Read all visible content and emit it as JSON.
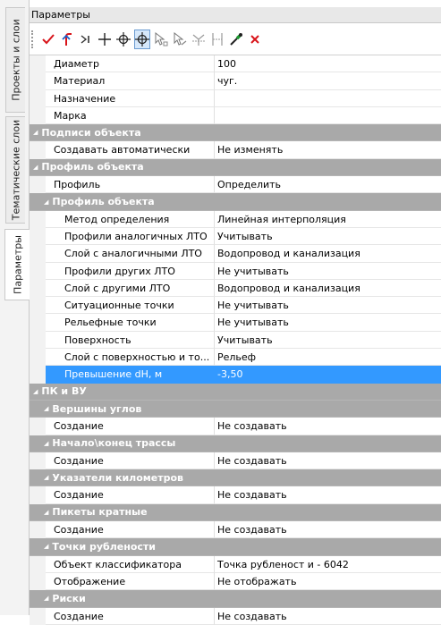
{
  "side_tabs": [
    {
      "label": "Проекты и слои"
    },
    {
      "label": "Тематические слои"
    },
    {
      "label": "Параметры"
    }
  ],
  "panel": {
    "title": "Параметры"
  },
  "toolbar": {
    "buttons": [
      {
        "icon": "check-icon"
      },
      {
        "icon": "undo-arrow-icon"
      },
      {
        "icon": "step-to-end-icon"
      },
      {
        "icon": "plus-icon"
      },
      {
        "icon": "crosshair-icon"
      },
      {
        "icon": "crosshair-pressed-icon"
      },
      {
        "icon": "select-node-icon"
      },
      {
        "icon": "select-segment-icon"
      },
      {
        "icon": "merge-icon"
      },
      {
        "icon": "split-icon"
      },
      {
        "icon": "eyedropper-icon"
      },
      {
        "icon": "delete-x-icon"
      }
    ]
  },
  "properties": [
    {
      "type": "prop",
      "level": 1,
      "key": "Диаметр",
      "value": "100"
    },
    {
      "type": "prop",
      "level": 1,
      "key": "Материал",
      "value": "чуг."
    },
    {
      "type": "prop",
      "level": 1,
      "key": "Назначение",
      "value": ""
    },
    {
      "type": "prop",
      "level": 1,
      "key": "Марка",
      "value": ""
    },
    {
      "type": "cat",
      "level": 0,
      "key": "Подписи объекта"
    },
    {
      "type": "prop",
      "level": 1,
      "key": "Создавать автоматически",
      "value": "Не изменять"
    },
    {
      "type": "cat",
      "level": 0,
      "key": "Профиль объекта"
    },
    {
      "type": "prop",
      "level": 1,
      "key": "Профиль",
      "value": "Определить"
    },
    {
      "type": "cat",
      "level": 1,
      "key": "Профиль объекта"
    },
    {
      "type": "prop",
      "level": 2,
      "key": "Метод определения",
      "value": "Линейная интерполяция"
    },
    {
      "type": "prop",
      "level": 2,
      "key": "Профили аналогичных ЛТО",
      "value": "Учитывать"
    },
    {
      "type": "prop",
      "level": 2,
      "key": "Слой с аналогичными ЛТО",
      "value": "Водопровод и канализация"
    },
    {
      "type": "prop",
      "level": 2,
      "key": "Профили других ЛТО",
      "value": "Не учитывать"
    },
    {
      "type": "prop",
      "level": 2,
      "key": "Слой с другими ЛТО",
      "value": "Водопровод и канализация"
    },
    {
      "type": "prop",
      "level": 2,
      "key": "Ситуационные точки",
      "value": "Не учитывать"
    },
    {
      "type": "prop",
      "level": 2,
      "key": "Рельефные точки",
      "value": "Не учитывать"
    },
    {
      "type": "prop",
      "level": 2,
      "key": "Поверхность",
      "value": "Учитывать"
    },
    {
      "type": "prop",
      "level": 2,
      "key": "Слой с поверхностью и то...",
      "value": "Рельеф"
    },
    {
      "type": "prop",
      "level": 2,
      "key": "Превышение dH, м",
      "value": "-3,50",
      "selected": true
    },
    {
      "type": "cat",
      "level": 0,
      "key": "ПК и ВУ"
    },
    {
      "type": "cat",
      "level": 1,
      "key": "Вершины углов"
    },
    {
      "type": "prop",
      "level": 1,
      "key": "Создание",
      "value": "Не создавать"
    },
    {
      "type": "cat",
      "level": 1,
      "key": "Начало\\конец трассы"
    },
    {
      "type": "prop",
      "level": 1,
      "key": "Создание",
      "value": "Не создавать"
    },
    {
      "type": "cat",
      "level": 1,
      "key": "Указатели километров"
    },
    {
      "type": "prop",
      "level": 1,
      "key": "Создание",
      "value": "Не создавать"
    },
    {
      "type": "cat",
      "level": 1,
      "key": "Пикеты кратные"
    },
    {
      "type": "prop",
      "level": 1,
      "key": "Создание",
      "value": "Не создавать"
    },
    {
      "type": "cat",
      "level": 1,
      "key": "Точки рублености"
    },
    {
      "type": "prop",
      "level": 1,
      "key": "Объект классификатора",
      "value": "Точка рубленост и - 6042"
    },
    {
      "type": "prop",
      "level": 1,
      "key": "Отображение",
      "value": "Не отображать"
    },
    {
      "type": "cat",
      "level": 1,
      "key": "Риски"
    },
    {
      "type": "prop",
      "level": 1,
      "key": "Создание",
      "value": "Не создавать"
    }
  ]
}
